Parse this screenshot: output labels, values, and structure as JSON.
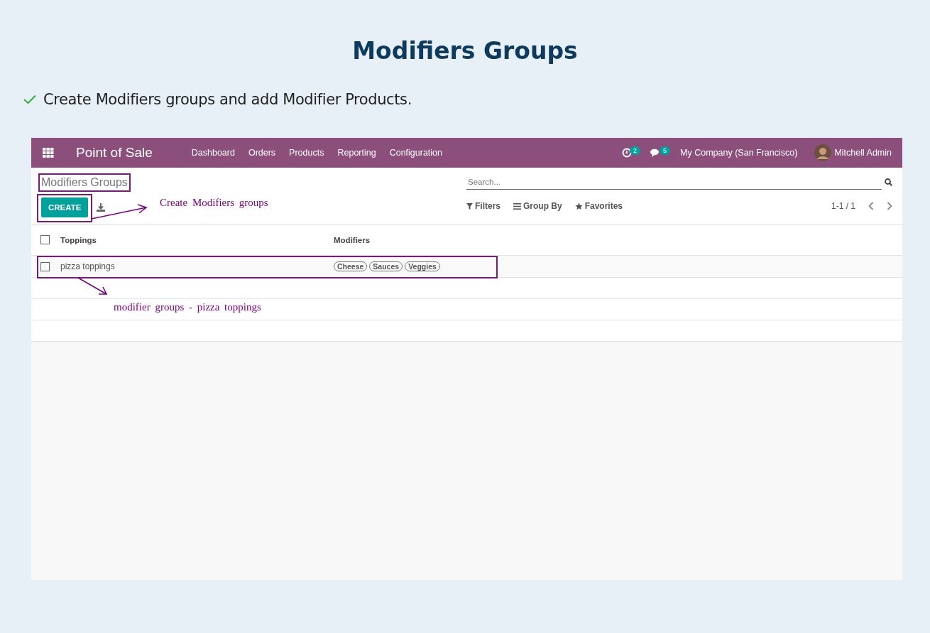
{
  "slide": {
    "title": "Modifiers Groups",
    "bullets": [
      "Create Modifiers groups and add Modifier Products."
    ]
  },
  "app": {
    "navbar": {
      "app_name": "Point of Sale",
      "menu": [
        "Dashboard",
        "Orders",
        "Products",
        "Reporting",
        "Configuration"
      ],
      "activity_count": "2",
      "message_count": "5",
      "company": "My Company (San Francisco)",
      "user": "Mitchell Admin"
    },
    "breadcrumb": "Modifiers Groups",
    "create_button": "CREATE",
    "search": {
      "placeholder": "Search..."
    },
    "filters": [
      {
        "kind": "filter",
        "label": "Filters"
      },
      {
        "kind": "group",
        "label": "Group By"
      },
      {
        "kind": "favorite",
        "label": "Favorites"
      }
    ],
    "pager": "1-1 / 1",
    "table": {
      "header_checked": false,
      "columns": [
        "Toppings",
        "Modifiers"
      ],
      "rows": [
        {
          "checked": false,
          "name": "pizza toppings",
          "tags": [
            "Cheese",
            "Sauces",
            "Veggies"
          ]
        }
      ]
    }
  },
  "annotations": [
    "Create Modifiers groups",
    "modifier groups - pizza toppings"
  ]
}
